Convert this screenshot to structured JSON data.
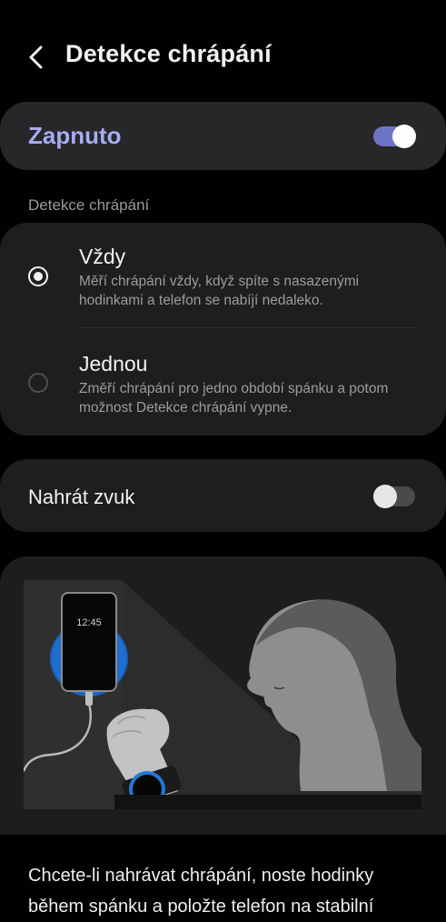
{
  "header": {
    "title": "Detekce chrápání"
  },
  "master": {
    "label": "Zapnuto",
    "enabled": true
  },
  "section_label": "Detekce chrápání",
  "options": [
    {
      "title": "Vždy",
      "description": "Měří chrápání vždy, když spíte s nasazenými hodinkami a telefon se nabíjí nedaleko.",
      "selected": true
    },
    {
      "title": "Jednou",
      "description": "Změří chrápání pro jedno období spánku a potom možnost Detekce chrápání vypne.",
      "selected": false
    }
  ],
  "record_sound": {
    "label": "Nahrát zvuk",
    "enabled": false
  },
  "illustration": {
    "phone_time": "12:45"
  },
  "footer": {
    "text": "Chcete-li nahrávat chrápání, noste hodinky během spánku a položte telefon na stabilní"
  },
  "colors": {
    "accent": "#a7adf1",
    "toggle_on": "#6d74c6",
    "charger": "#1f6fd1",
    "background": "#010101"
  }
}
